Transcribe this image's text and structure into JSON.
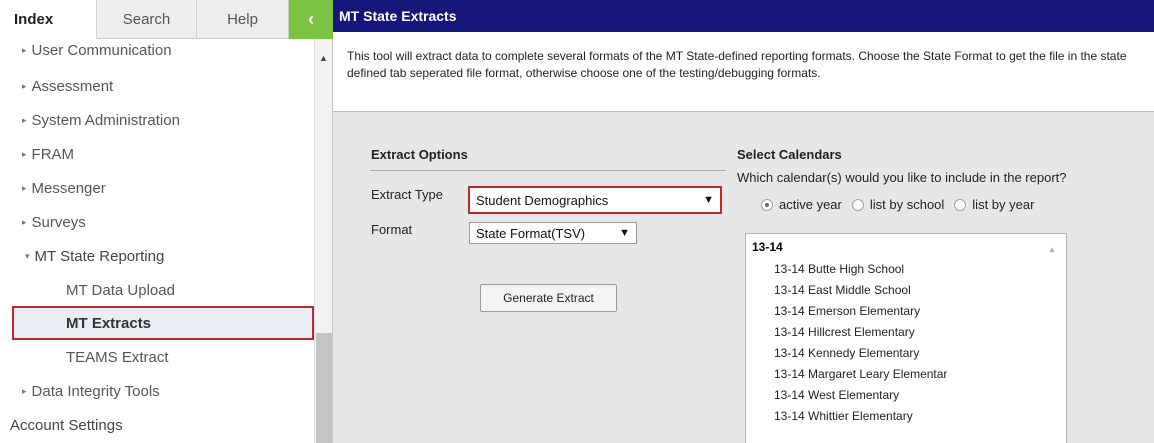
{
  "sidebar": {
    "tabs": {
      "index": "Index",
      "search": "Search",
      "help": "Help",
      "collapse": "‹"
    },
    "items": [
      {
        "label": "User Communication",
        "tri": "▸"
      },
      {
        "label": "Assessment",
        "tri": "▸"
      },
      {
        "label": "System Administration",
        "tri": "▸"
      },
      {
        "label": "FRAM",
        "tri": "▸"
      },
      {
        "label": "Messenger",
        "tri": "▸"
      },
      {
        "label": "Surveys",
        "tri": "▸"
      },
      {
        "label": "MT State Reporting",
        "tri": "▾"
      },
      {
        "label": "MT Data Upload"
      },
      {
        "label": "MT Extracts"
      },
      {
        "label": "TEAMS Extract"
      },
      {
        "label": "Data Integrity Tools",
        "tri": "▸"
      },
      {
        "label": "Account Settings"
      }
    ]
  },
  "main": {
    "title": "MT State Extracts",
    "description": "This tool will extract data to complete several formats of the MT State-defined reporting formats. Choose the State Format to get the file in the state defined tab seperated file format, otherwise choose one of the testing/debugging formats.",
    "extract_options": {
      "title": "Extract Options",
      "extract_type_label": "Extract Type",
      "extract_type_value": "Student Demographics",
      "format_label": "Format",
      "format_value": "State Format(TSV)",
      "generate_label": "Generate Extract"
    },
    "calendars": {
      "title": "Select Calendars",
      "question": "Which calendar(s) would you like to include in the report?",
      "radio": [
        "active year",
        "list by school",
        "list by year"
      ],
      "group": "13-14",
      "items": [
        "13-14 Butte High School",
        "13-14 East Middle School",
        "13-14 Emerson Elementary",
        "13-14 Hillcrest Elementary",
        "13-14 Kennedy Elementary",
        "13-14 Margaret Leary Elementar",
        "13-14 West Elementary",
        "13-14 Whittier Elementary"
      ]
    }
  },
  "colors": {
    "title_bar": "#16167a",
    "highlight_border": "#c0272d",
    "collapse_green": "#7cc242"
  }
}
